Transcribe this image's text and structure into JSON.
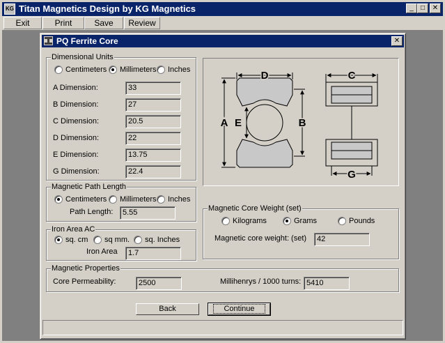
{
  "app": {
    "icon_text": "KG",
    "title": "Titan Magnetics Design by KG Magnetics",
    "minimize_glyph": "_",
    "maximize_glyph": "□",
    "close_glyph": "✕"
  },
  "menu": {
    "items": [
      {
        "label": "Exit"
      },
      {
        "label": "Print"
      },
      {
        "label": "Save"
      },
      {
        "label": "Review"
      }
    ]
  },
  "dialog": {
    "icon": "core-icon",
    "title": "PQ Ferrite Core",
    "close_glyph": "✕"
  },
  "dimensional_units": {
    "label": "Dimensional Units",
    "options": [
      "Centimeters",
      "Millimeters",
      "Inches"
    ],
    "selected": "Millimeters",
    "dimensions": [
      {
        "label": "A Dimension:",
        "value": "33"
      },
      {
        "label": "B Dimension:",
        "value": "27"
      },
      {
        "label": "C Dimension:",
        "value": "20.5"
      },
      {
        "label": "D Dimension:",
        "value": "22"
      },
      {
        "label": "E Dimension:",
        "value": "13.75"
      },
      {
        "label": "G Dimension:",
        "value": "22.4"
      }
    ]
  },
  "diagram": {
    "labels": {
      "A": "A",
      "B": "B",
      "C": "C",
      "D": "D",
      "E": "E",
      "G": "G"
    }
  },
  "magnetic_path_length": {
    "label": "Magnetic Path Length",
    "options": [
      "Centimeters",
      "Millimeters",
      "Inches"
    ],
    "selected": "Centimeters",
    "path_label": "Path Length:",
    "path_value": "5.55"
  },
  "iron_area": {
    "label": "Iron Area AC",
    "options": [
      "sq. cm",
      "sq mm.",
      "sq. Inches"
    ],
    "selected": "sq. cm",
    "area_label": "Iron Area",
    "area_value": "1.7"
  },
  "core_weight": {
    "label": "Magnetic Core Weight (set)",
    "options": [
      "Kilograms",
      "Grams",
      "Pounds"
    ],
    "selected": "Grams",
    "weight_label": "Magnetic core weight: (set)",
    "weight_value": "42"
  },
  "magnetic_properties": {
    "label": "Magnetic Properties",
    "permeability_label": "Core Permeability:",
    "permeability_value": "2500",
    "mh_label": "Millihenrys / 1000 turns:",
    "mh_value": "5410"
  },
  "buttons": {
    "back": "Back",
    "continue": "Continue"
  },
  "status": {
    "text": ""
  }
}
